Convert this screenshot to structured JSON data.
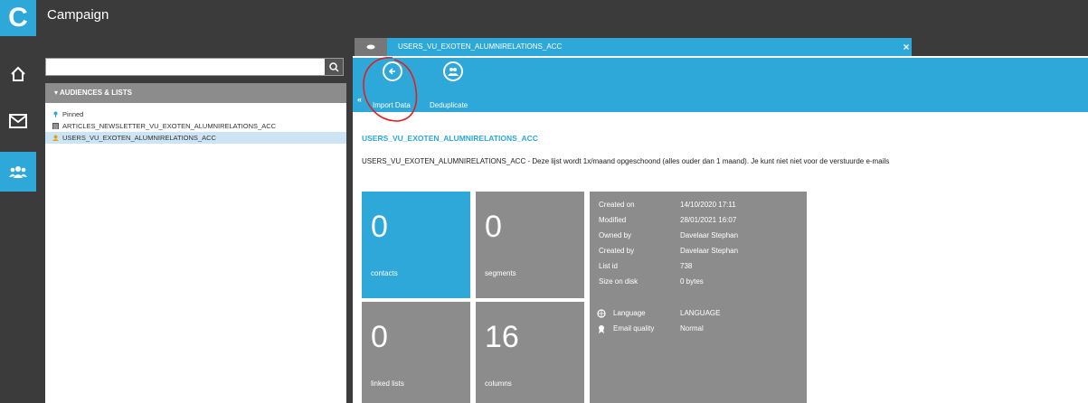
{
  "app": {
    "logo_letter": "C",
    "title": "Campaign"
  },
  "search": {
    "value": "",
    "placeholder": ""
  },
  "audiences": {
    "header": "AUDIENCES & LISTS",
    "items": [
      {
        "label": "Pinned",
        "icon": "pin-icon"
      },
      {
        "label": "ARTICLES_NEWSLETTER_VU_EXOTEN_ALUMNIRELATIONS_ACC",
        "icon": "list-icon"
      },
      {
        "label": "USERS_VU_EXOTEN_ALUMNIRELATIONS_ACC",
        "icon": "users-icon"
      }
    ]
  },
  "tab": {
    "title": "USERS_VU_EXOTEN_ALUMNIRELATIONS_ACC",
    "close": "×"
  },
  "toolbar": {
    "import_label": "Import Data",
    "dedup_label": "Deduplicate",
    "collapse": "«"
  },
  "detail": {
    "title": "USERS_VU_EXOTEN_ALUMNIRELATIONS_ACC",
    "description": "USERS_VU_EXOTEN_ALUMNIRELATIONS_ACC - Deze lijst wordt 1x/maand opgeschoond (alles ouder dan 1 maand). Je kunt niet niet voor de verstuurde e-mails"
  },
  "stats": {
    "contacts": {
      "value": "0",
      "label": "contacts"
    },
    "segments": {
      "value": "0",
      "label": "segments"
    },
    "linked": {
      "value": "0",
      "label": "linked lists"
    },
    "columns": {
      "value": "16",
      "label": "columns"
    }
  },
  "info": {
    "rows": [
      {
        "key": "Created on",
        "value": "14/10/2020 17:11"
      },
      {
        "key": "Modified",
        "value": "28/01/2021 16:07"
      },
      {
        "key": "Owned by",
        "value": "Davelaar Stephan"
      },
      {
        "key": "Created by",
        "value": "Davelaar Stephan"
      },
      {
        "key": "List id",
        "value": "738"
      },
      {
        "key": "Size on disk",
        "value": "0 bytes"
      }
    ],
    "language_key": "Language",
    "language_value": "LANGUAGE",
    "quality_key": "Email quality",
    "quality_value": "Normal"
  },
  "colors": {
    "accent": "#2ea7d9",
    "dark": "#3b3b3b",
    "tile_gray": "#8c8c8c",
    "annotation": "#e02020"
  }
}
